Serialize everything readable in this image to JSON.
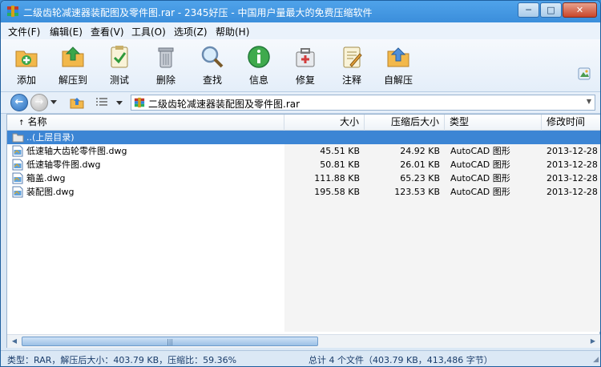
{
  "window": {
    "title": "二级齿轮减速器装配图及零件图.rar - 2345好压 - 中国用户量最大的免费压缩软件",
    "controls": {
      "minimize": "─",
      "maximize": "□",
      "close": "✕"
    }
  },
  "menu": [
    "文件(F)",
    "编辑(E)",
    "查看(V)",
    "工具(O)",
    "选项(Z)",
    "帮助(H)"
  ],
  "toolbar": [
    {
      "label": "添加",
      "icon": "add-icon"
    },
    {
      "label": "解压到",
      "icon": "extract-to-icon"
    },
    {
      "label": "测试",
      "icon": "test-icon"
    },
    {
      "label": "删除",
      "icon": "delete-icon"
    },
    {
      "label": "查找",
      "icon": "search-icon"
    },
    {
      "label": "信息",
      "icon": "info-icon"
    },
    {
      "label": "修复",
      "icon": "repair-icon"
    },
    {
      "label": "注释",
      "icon": "comment-icon"
    },
    {
      "label": "自解压",
      "icon": "self-extract-icon"
    }
  ],
  "address": {
    "path": "二级齿轮减速器装配图及零件图.rar"
  },
  "columns": [
    "名称",
    "大小",
    "压缩后大小",
    "类型",
    "修改时间"
  ],
  "up_row": "..(上层目录)",
  "files": [
    {
      "name": "低速轴大齿轮零件图.dwg",
      "size": "45.51 KB",
      "packed": "24.92 KB",
      "type": "AutoCAD 图形",
      "modified": "2013-12-28"
    },
    {
      "name": "低速轴零件图.dwg",
      "size": "50.81 KB",
      "packed": "26.01 KB",
      "type": "AutoCAD 图形",
      "modified": "2013-12-28"
    },
    {
      "name": "箱盖.dwg",
      "size": "111.88 KB",
      "packed": "65.23 KB",
      "type": "AutoCAD 图形",
      "modified": "2013-12-28"
    },
    {
      "name": "装配图.dwg",
      "size": "195.58 KB",
      "packed": "123.53 KB",
      "type": "AutoCAD 图形",
      "modified": "2013-12-28"
    }
  ],
  "status": {
    "left": "类型：RAR，解压后大小：403.79 KB，压缩比：59.36%",
    "right": "总计 4 个文件（403.79 KB，413,486 字节）"
  },
  "colors": {
    "titlebar": "#3b8edb",
    "selection": "#3c85d4"
  }
}
